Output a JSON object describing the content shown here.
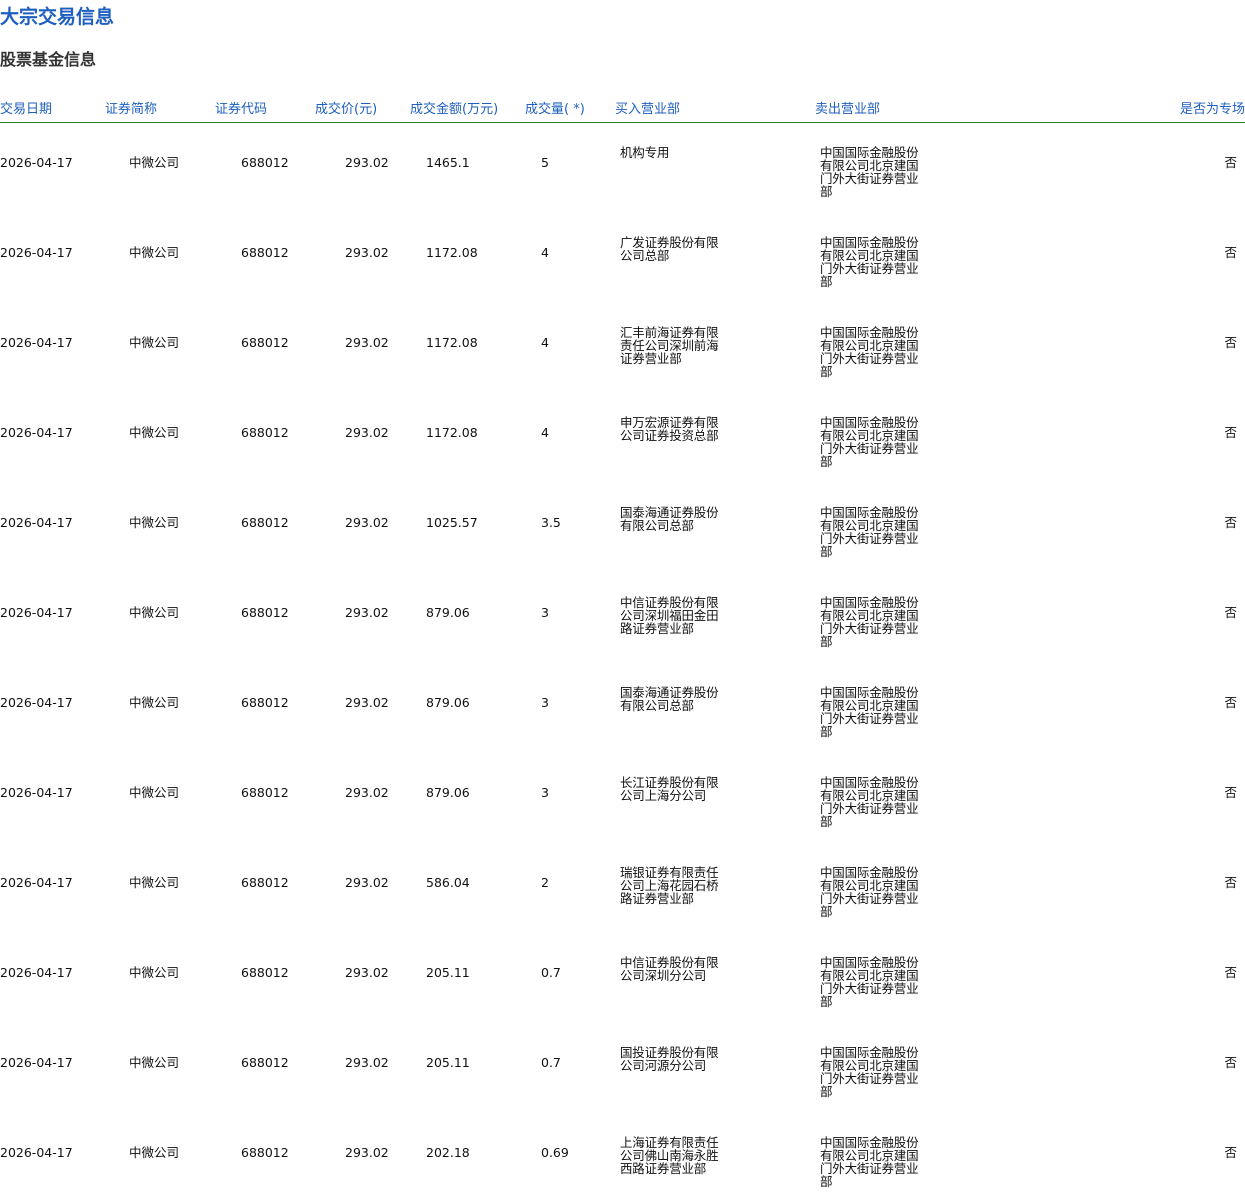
{
  "page": {
    "title": "大宗交易信息",
    "section_title": "股票基金信息"
  },
  "table": {
    "headers": {
      "date": "交易日期",
      "name": "证券简称",
      "code": "证券代码",
      "price": "成交价(元)",
      "amount": "成交金额(万元)",
      "volume": "成交量( *)",
      "buyer": "买入营业部",
      "seller": "卖出营业部",
      "special": "是否为专场"
    },
    "rows": [
      {
        "date": "2026-04-17",
        "name": "中微公司",
        "code": "688012",
        "price": "293.02",
        "amount": "1465.1",
        "volume": "5",
        "buyer": "机构专用",
        "seller": "中国国际金融股份有限公司北京建国门外大街证券营业部",
        "special": "否"
      },
      {
        "date": "2026-04-17",
        "name": "中微公司",
        "code": "688012",
        "price": "293.02",
        "amount": "1172.08",
        "volume": "4",
        "buyer": "广发证券股份有限公司总部",
        "seller": "中国国际金融股份有限公司北京建国门外大街证券营业部",
        "special": "否"
      },
      {
        "date": "2026-04-17",
        "name": "中微公司",
        "code": "688012",
        "price": "293.02",
        "amount": "1172.08",
        "volume": "4",
        "buyer": "汇丰前海证券有限责任公司深圳前海证券营业部",
        "seller": "中国国际金融股份有限公司北京建国门外大街证券营业部",
        "special": "否"
      },
      {
        "date": "2026-04-17",
        "name": "中微公司",
        "code": "688012",
        "price": "293.02",
        "amount": "1172.08",
        "volume": "4",
        "buyer": "申万宏源证券有限公司证券投资总部",
        "seller": "中国国际金融股份有限公司北京建国门外大街证券营业部",
        "special": "否"
      },
      {
        "date": "2026-04-17",
        "name": "中微公司",
        "code": "688012",
        "price": "293.02",
        "amount": "1025.57",
        "volume": "3.5",
        "buyer": "国泰海通证券股份有限公司总部",
        "seller": "中国国际金融股份有限公司北京建国门外大街证券营业部",
        "special": "否"
      },
      {
        "date": "2026-04-17",
        "name": "中微公司",
        "code": "688012",
        "price": "293.02",
        "amount": "879.06",
        "volume": "3",
        "buyer": "中信证券股份有限公司深圳福田金田路证券营业部",
        "seller": "中国国际金融股份有限公司北京建国门外大街证券营业部",
        "special": "否"
      },
      {
        "date": "2026-04-17",
        "name": "中微公司",
        "code": "688012",
        "price": "293.02",
        "amount": "879.06",
        "volume": "3",
        "buyer": "国泰海通证券股份有限公司总部",
        "seller": "中国国际金融股份有限公司北京建国门外大街证券营业部",
        "special": "否"
      },
      {
        "date": "2026-04-17",
        "name": "中微公司",
        "code": "688012",
        "price": "293.02",
        "amount": "879.06",
        "volume": "3",
        "buyer": "长江证券股份有限公司上海分公司",
        "seller": "中国国际金融股份有限公司北京建国门外大街证券营业部",
        "special": "否"
      },
      {
        "date": "2026-04-17",
        "name": "中微公司",
        "code": "688012",
        "price": "293.02",
        "amount": "586.04",
        "volume": "2",
        "buyer": "瑞银证券有限责任公司上海花园石桥路证券营业部",
        "seller": "中国国际金融股份有限公司北京建国门外大街证券营业部",
        "special": "否"
      },
      {
        "date": "2026-04-17",
        "name": "中微公司",
        "code": "688012",
        "price": "293.02",
        "amount": "205.11",
        "volume": "0.7",
        "buyer": "中信证券股份有限公司深圳分公司",
        "seller": "中国国际金融股份有限公司北京建国门外大街证券营业部",
        "special": "否"
      },
      {
        "date": "2026-04-17",
        "name": "中微公司",
        "code": "688012",
        "price": "293.02",
        "amount": "205.11",
        "volume": "0.7",
        "buyer": "国投证券股份有限公司河源分公司",
        "seller": "中国国际金融股份有限公司北京建国门外大街证券营业部",
        "special": "否"
      },
      {
        "date": "2026-04-17",
        "name": "中微公司",
        "code": "688012",
        "price": "293.02",
        "amount": "202.18",
        "volume": "0.69",
        "buyer": "上海证券有限责任公司佛山南海永胜西路证券营业部",
        "seller": "中国国际金融股份有限公司北京建国门外大街证券营业部",
        "special": "否"
      }
    ]
  }
}
